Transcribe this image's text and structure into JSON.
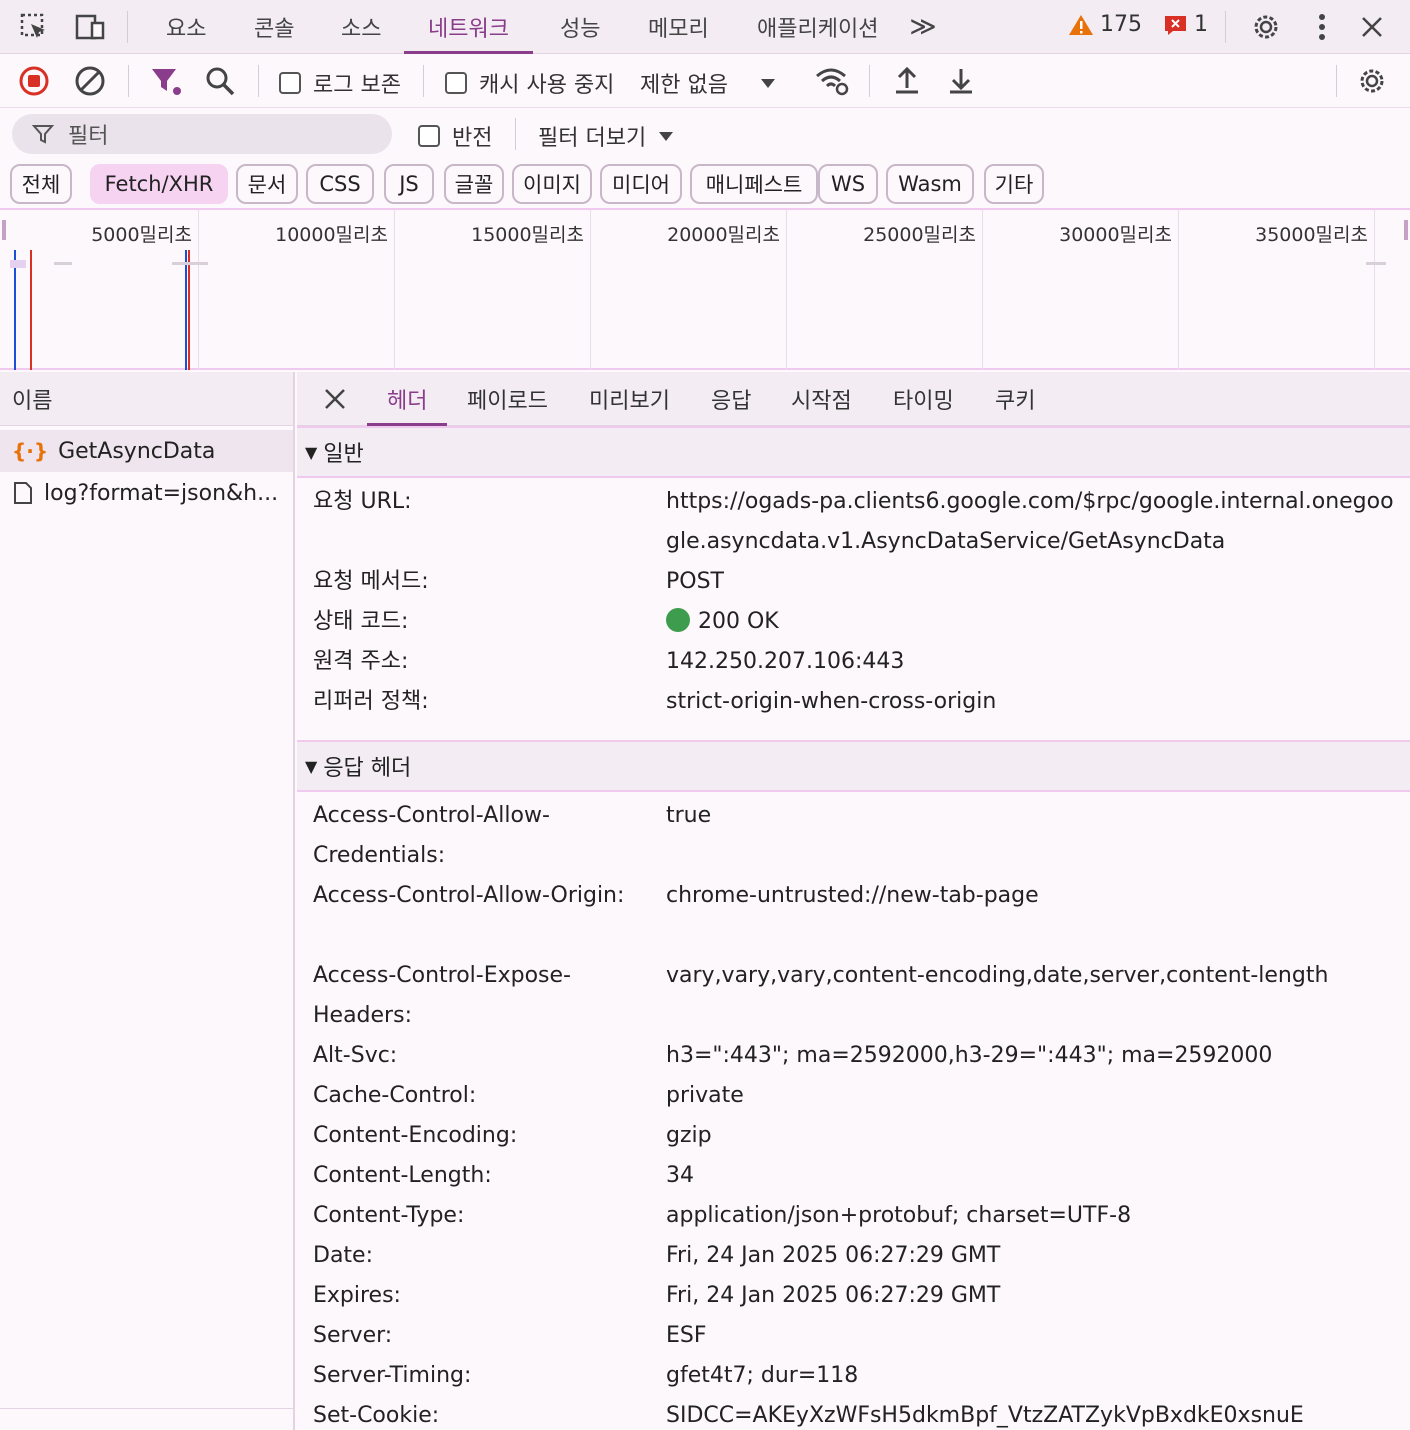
{
  "top_tabs": [
    "요소",
    "콘솔",
    "소스",
    "네트워크",
    "성능",
    "메모리",
    "애플리케이션"
  ],
  "active_tab_index": 3,
  "more_tabs": "≫",
  "warnings_count": "175",
  "errors_count": "1",
  "toolbar": {
    "preserve_log": "로그 보존",
    "disable_cache": "캐시 사용 중지",
    "throttle": "제한 없음"
  },
  "filter": {
    "placeholder": "필터",
    "invert": "반전",
    "more_filters": "필터 더보기"
  },
  "chips": [
    "전체",
    "Fetch/XHR",
    "문서",
    "CSS",
    "JS",
    "글꼴",
    "이미지",
    "미디어",
    "매니페스트",
    "WS",
    "Wasm",
    "기타"
  ],
  "active_chip_index": 1,
  "timeline_ticks": [
    "5000밀리초",
    "10000밀리초",
    "15000밀리초",
    "20000밀리초",
    "25000밀리초",
    "30000밀리초",
    "35000밀리초"
  ],
  "requests_panel": {
    "header": "이름",
    "rows": [
      {
        "name": "GetAsyncData",
        "icon": "fetch-icon"
      },
      {
        "name": "log?format=json&h...",
        "icon": "document-icon"
      }
    ]
  },
  "detail_tabs": [
    "헤더",
    "페이로드",
    "미리보기",
    "응답",
    "시작점",
    "타이밍",
    "쿠키"
  ],
  "active_detail_tab_index": 0,
  "general": {
    "title": "일반",
    "rows": [
      {
        "key": "요청 URL:",
        "value": "https://ogads-pa.clients6.google.com/$rpc/google.internal.onegoogle.asyncdata.v1.AsyncDataService/GetAsyncData"
      },
      {
        "key": "요청 메서드:",
        "value": "POST"
      },
      {
        "key": "상태 코드:",
        "value": "200 OK"
      },
      {
        "key": "원격 주소:",
        "value": "142.250.207.106:443"
      },
      {
        "key": "리퍼러 정책:",
        "value": "strict-origin-when-cross-origin"
      }
    ]
  },
  "response_headers": {
    "title": "응답 헤더",
    "rows": [
      {
        "key": "Access-Control-Allow-Credentials:",
        "value": "true"
      },
      {
        "key": "Access-Control-Allow-Origin:",
        "value": "chrome-untrusted://new-tab-page"
      },
      {
        "key": "Access-Control-Expose-Headers:",
        "value": "vary,vary,vary,content-encoding,date,server,content-length"
      },
      {
        "key": "Alt-Svc:",
        "value": "h3=\":443\"; ma=2592000,h3-29=\":443\"; ma=2592000"
      },
      {
        "key": "Cache-Control:",
        "value": "private"
      },
      {
        "key": "Content-Encoding:",
        "value": "gzip"
      },
      {
        "key": "Content-Length:",
        "value": "34"
      },
      {
        "key": "Content-Type:",
        "value": "application/json+protobuf; charset=UTF-8"
      },
      {
        "key": "Date:",
        "value": "Fri, 24 Jan 2025 06:27:29 GMT"
      },
      {
        "key": "Expires:",
        "value": "Fri, 24 Jan 2025 06:27:29 GMT"
      },
      {
        "key": "Server:",
        "value": "ESF"
      },
      {
        "key": "Server-Timing:",
        "value": "gfet4t7; dur=118"
      },
      {
        "key": "Set-Cookie:",
        "value": "SIDCC=AKEyXzWFsH5dkmBpf_VtzZATZykVpBxdkE0xsnuE"
      }
    ]
  },
  "colors": {
    "accent": "#8a3d8a",
    "status_ok": "#3e9c4f",
    "record": "#d93025",
    "warning": "#e8710a",
    "error": "#d93025"
  }
}
